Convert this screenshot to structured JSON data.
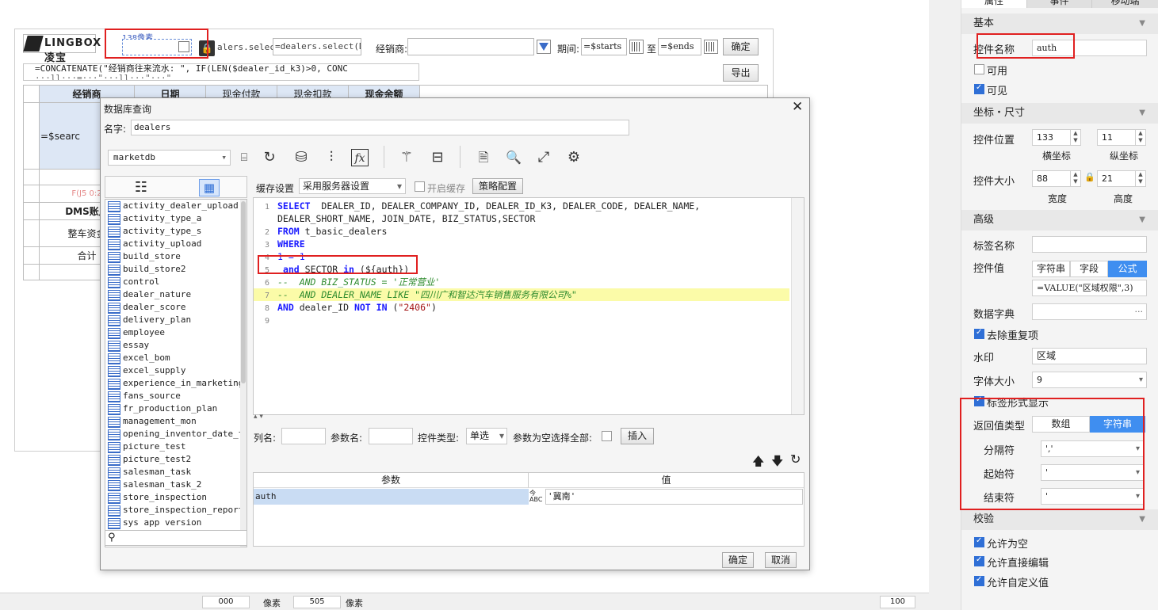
{
  "canvas": {
    "logo": "LINGBOX 凌宝",
    "widget_caption": "138像素",
    "formula_a": "alers.select",
    "formula_b": "=dealers.select(DE",
    "dealer_label": "经销商:",
    "period_label": "期间:",
    "start_value": "=$starts",
    "to_label": "至",
    "end_value": "=$ends",
    "confirm_btn": "确定",
    "export_btn": "导出",
    "concat_line1": "=CONCATENATE(\"经销商往来流水: \",  IF(LEN($dealer_id_k3)>0,  CONC",
    "concat_line2": "  ···ll···=···\"···ll···\"···\"",
    "headers": [
      "经销商",
      "日期",
      "现金付款",
      "现金扣款",
      "现金余额"
    ],
    "search_cell": "=$searc",
    "pink_cell": "F(J5 0:2",
    "dms_cell": "DMS账户",
    "fund_cell": "整车资金",
    "total_cell": "合计"
  },
  "statusbar": {
    "value1": "000",
    "unit1": "像素",
    "value2": "505",
    "unit2": "像素",
    "zoom": "100"
  },
  "dialog": {
    "title": "数据库查询",
    "name_label": "名字:",
    "name_value": "dealers",
    "db_select": "marketdb",
    "cache_label": "缓存设置",
    "cache_option": "采用服务器设置",
    "enable_cache": "开启缓存",
    "policy_btn": "策略配置",
    "tables": [
      "activity_dealer_upload",
      "activity_type_a",
      "activity_type_s",
      "activity_upload",
      "build_store",
      "build_store2",
      "control",
      "dealer_nature",
      "dealer_score",
      "delivery_plan",
      "employee",
      "essay",
      "excel_bom",
      "excel_supply",
      "experience_in_marketing",
      "fans_source",
      "fr_production_plan",
      "management_mon",
      "opening_inventor_date_ten",
      "picture_test",
      "picture_test2",
      "salesman_task",
      "salesman_task_2",
      "store_inspection",
      "store_inspection_report",
      "sys app version"
    ],
    "sql": [
      {
        "n": "1",
        "html": "<span class='kw'>SELECT</span>  DEALER_ID, DEALER_COMPANY_ID, DEALER_ID_K3, DEALER_CODE, DEALER_NAME,"
      },
      {
        "n": "",
        "html": "DEALER_SHORT_NAME, JOIN_DATE, BIZ_STATUS,SECTOR"
      },
      {
        "n": "2",
        "html": "<span class='kw'>FROM</span> t_basic_dealers"
      },
      {
        "n": "3",
        "html": "<span class='kw'>WHERE</span>"
      },
      {
        "n": "4",
        "html": "<span style='color:#1a1aff'>1 = 1</span>"
      },
      {
        "n": "5",
        "html": " <span class='kw'>and</span> SECTOR <span class='kw'>in</span> (${auth})"
      },
      {
        "n": "6",
        "html": "<span class='cmt'>--  AND BIZ_STATUS = '正常营业'</span>"
      },
      {
        "n": "7",
        "html": "<span class='cmt'>--  AND DEALER_NAME LIKE \"四川广和智达汽车销售服务有限公司%\"</span>"
      },
      {
        "n": "8",
        "html": "<span class='kw'>AND</span> dealer_ID <span class='kw'>NOT</span> <span class='kw'>IN</span> (<span class='str'>\"2406\"</span>)"
      },
      {
        "n": "9",
        "html": ""
      }
    ],
    "col_name_label": "列名:",
    "param_name_label": "参数名:",
    "ctrl_type_label": "控件类型:",
    "ctrl_type_value": "单选",
    "empty_select_all_label": "参数为空选择全部:",
    "insert_btn": "插入",
    "param_header": "参数",
    "value_header": "值",
    "param_name": "auth",
    "param_value": "'冀南'",
    "ok_btn": "确定",
    "cancel_btn": "取消"
  },
  "panel": {
    "tab_props": "属性",
    "tab_events": "事件",
    "tab_mobile": "移动端",
    "section_basic": "基本",
    "ctrl_name_label": "控件名称",
    "ctrl_name_value": "auth",
    "enable_label": "可用",
    "visible_label": "可见",
    "section_coords": "坐标・尺寸",
    "pos_label": "控件位置",
    "pos_x": "133",
    "pos_y": "11",
    "x_label": "横坐标",
    "y_label": "纵坐标",
    "size_label": "控件大小",
    "width": "88",
    "height": "21",
    "w_label": "宽度",
    "h_label": "高度",
    "section_adv": "高级",
    "tagname_label": "标签名称",
    "ctrl_value_label": "控件值",
    "seg_string": "字符串",
    "seg_field": "字段",
    "seg_formula": "公式",
    "ctrl_value": "=VALUE(\"区域权限\",3)",
    "dict_label": "数据字典",
    "dedupe_label": "去除重复项",
    "watermark_label": "水印",
    "watermark_value": "区域",
    "fontsize_label": "字体大小",
    "fontsize_value": "9",
    "tagmode_label": "标签形式显示",
    "return_type_label": "返回值类型",
    "ret_array": "数组",
    "ret_string": "字符串",
    "sep_label": "分隔符",
    "sep_value": "','",
    "start_label": "起始符",
    "start_value": "'",
    "end_label": "结束符",
    "end_value": "'",
    "section_check": "校验",
    "allow_empty": "允许为空",
    "allow_edit": "允许直接编辑",
    "allow_custom": "允许自定义值"
  }
}
